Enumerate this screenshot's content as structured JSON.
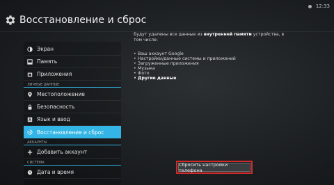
{
  "status": {
    "time": "12:33"
  },
  "header": {
    "title": "Восстановление и сброс",
    "icon": "gear-icon"
  },
  "sidebar": {
    "items_top": [
      {
        "label": "Экран",
        "icon": "brightness-icon"
      },
      {
        "label": "Память",
        "icon": "storage-icon"
      },
      {
        "label": "Приложения",
        "icon": "apps-icon"
      }
    ],
    "section_personal": "ЛИЧНЫЕ ДАННЫЕ",
    "items_personal": [
      {
        "label": "Местоположение",
        "icon": "location-icon"
      },
      {
        "label": "Безопасность",
        "icon": "lock-icon"
      },
      {
        "label": "Язык и ввод",
        "icon": "language-icon"
      },
      {
        "label": "Восстановление и сброс",
        "icon": "restore-icon",
        "selected": true
      }
    ],
    "section_accounts": "АККАУНТЫ",
    "items_accounts": [
      {
        "label": "Добавить аккаунт",
        "icon": "plus-icon"
      }
    ],
    "section_system": "СИСТЕМА",
    "items_system": [
      {
        "label": "Дата и время",
        "icon": "clock-icon"
      }
    ]
  },
  "content": {
    "intro_start": "Будут удалены все данные из",
    "intro_bold": "внутренней памяти",
    "intro_end": "устройства, в том числе:",
    "bullets": [
      "Ваш аккаунт Google",
      "Настройки/данные системы и приложений",
      "Загруженные приложения",
      "Музыка",
      "Фото",
      "Другие данные"
    ]
  },
  "reset_button": {
    "label": "Сбросить настройки телефона"
  },
  "colors": {
    "accent": "#33b5e5",
    "highlight": "#cf2b2b"
  }
}
